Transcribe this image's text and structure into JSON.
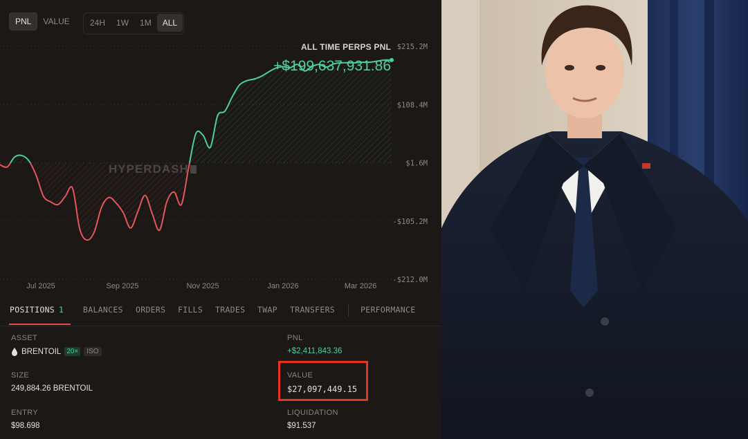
{
  "toggles": {
    "mode": [
      "PNL",
      "VALUE"
    ],
    "mode_active": "PNL",
    "range": [
      "24H",
      "1W",
      "1M",
      "ALL"
    ],
    "range_active": "ALL"
  },
  "chart_header": {
    "title": "ALL TIME PERPS PNL",
    "value": "+$199,637,931.86"
  },
  "watermark": "HYPERDASH",
  "chart_data": {
    "type": "area",
    "title": "ALL TIME PERPS PNL",
    "x_tick_labels": [
      "Jul 2025",
      "Sep 2025",
      "Nov 2025",
      "Jan 2026",
      "Mar 2026"
    ],
    "y_tick_labels": [
      "$215.2M",
      "$108.4M",
      "$1.6M",
      "-$105.2M",
      "-$212.0M"
    ],
    "ylim": [
      -212.0,
      215.2
    ],
    "y_unit": "$M",
    "baseline": 1.6,
    "series": [
      {
        "values": [
          -2,
          -6,
          12,
          15,
          5,
          -22,
          -60,
          -70,
          -75,
          -60,
          -45,
          -120,
          -140,
          -125,
          -80,
          -62,
          -72,
          -90,
          -118,
          -88,
          -58,
          -92,
          -122,
          -70,
          -52,
          -75,
          -8,
          55,
          52,
          30,
          88,
          96,
          122,
          144,
          152,
          155,
          160,
          168,
          175,
          178,
          176,
          182,
          170,
          178,
          182,
          177,
          183,
          185,
          185,
          185,
          186,
          186,
          188,
          190,
          190
        ]
      }
    ],
    "colors": {
      "positive": "#4fd09a",
      "negative": "#e5575b"
    },
    "grid": "dotted horizontal"
  },
  "tabs": [
    {
      "label": "POSITIONS",
      "count": "1"
    },
    {
      "label": "BALANCES"
    },
    {
      "label": "ORDERS"
    },
    {
      "label": "FILLS"
    },
    {
      "label": "TRADES"
    },
    {
      "label": "TWAP"
    },
    {
      "label": "TRANSFERS"
    },
    {
      "label": "PERFORMANCE"
    }
  ],
  "position": {
    "asset_label": "ASSET",
    "asset": "BRENTOIL",
    "leverage": "20×",
    "margin_mode": "ISO",
    "pnl_label": "PNL",
    "pnl": "+$2,411,843.36",
    "size_label": "SIZE",
    "size": "249,884.26 BRENTOIL",
    "value_label": "VALUE",
    "value": "$27,097,449.15",
    "entry_label": "ENTRY",
    "entry": "$98.698",
    "liquidation_label": "LIQUIDATION",
    "liquidation": "$91.537"
  },
  "colors": {
    "background": "#1b1816",
    "accent_green": "#4fd09a",
    "accent_red": "#e5575b",
    "highlight_box": "#e5341f"
  }
}
